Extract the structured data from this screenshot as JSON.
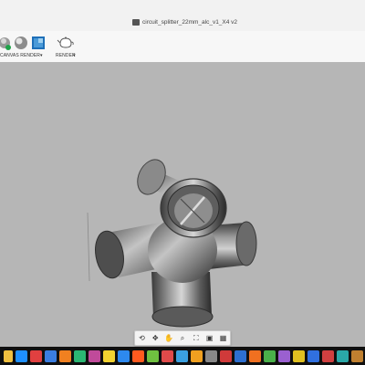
{
  "window": {
    "title": "circuit_splitter_22mm_alc_v1_X4 v2"
  },
  "toolbar": {
    "canvas_render_label": "CANVAS RENDER",
    "render_label": "RENDER",
    "canvas_icon": "canvas-render-icon",
    "render_icon": "teapot-icon"
  },
  "viewport": {
    "background": "#b6b6b6",
    "model_color": "#7a7a7a"
  },
  "navbar": {
    "buttons": [
      "orbit-icon",
      "pan-icon",
      "hand-icon",
      "zoom-icon",
      "fit-icon",
      "display-icon",
      "grid-icon"
    ]
  },
  "taskbar": {
    "apps": [
      {
        "name": "file-explorer-icon",
        "color": "#f0c040"
      },
      {
        "name": "app-icon",
        "color": "#1e90ff"
      },
      {
        "name": "app-icon",
        "color": "#e04040"
      },
      {
        "name": "app-icon",
        "color": "#3a7de0"
      },
      {
        "name": "app-icon",
        "color": "#f08020"
      },
      {
        "name": "app-icon",
        "color": "#2bb673"
      },
      {
        "name": "app-icon",
        "color": "#c04a9a"
      },
      {
        "name": "app-icon",
        "color": "#f2d230"
      },
      {
        "name": "app-icon",
        "color": "#2d89ef"
      },
      {
        "name": "app-icon",
        "color": "#ff5a1f"
      },
      {
        "name": "app-icon",
        "color": "#6fc040"
      },
      {
        "name": "app-icon",
        "color": "#e04a4a"
      },
      {
        "name": "app-icon",
        "color": "#3aa0e0"
      },
      {
        "name": "app-icon",
        "color": "#f0a020"
      },
      {
        "name": "app-icon",
        "color": "#888888"
      },
      {
        "name": "app-icon",
        "color": "#d03a3a"
      },
      {
        "name": "app-icon",
        "color": "#2d6fd0"
      },
      {
        "name": "app-icon",
        "color": "#f07020"
      },
      {
        "name": "app-icon",
        "color": "#4ab04a"
      },
      {
        "name": "app-icon",
        "color": "#9a60d0"
      },
      {
        "name": "app-icon",
        "color": "#e0c020"
      },
      {
        "name": "app-icon",
        "color": "#3070e0"
      },
      {
        "name": "app-icon",
        "color": "#d04040"
      },
      {
        "name": "app-icon",
        "color": "#2aa8a8"
      },
      {
        "name": "app-icon",
        "color": "#c08030"
      }
    ]
  }
}
